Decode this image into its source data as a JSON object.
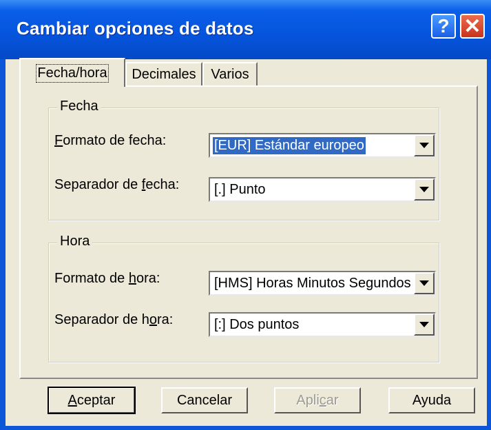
{
  "window": {
    "title": "Cambiar opciones de datos",
    "help_label": "?",
    "close_label": "✕"
  },
  "tabs": [
    {
      "label": "Fecha/hora",
      "active": true
    },
    {
      "label": "Decimales",
      "active": false
    },
    {
      "label": "Varios",
      "active": false
    }
  ],
  "fecha": {
    "group_title": "Fecha",
    "format_label_pre": "",
    "format_label_u": "F",
    "format_label_post": "ormato de fecha:",
    "format_value": "[EUR] Estándar europeo",
    "sep_label_pre": "Separador de ",
    "sep_label_u": "f",
    "sep_label_post": "echa:",
    "sep_value": "[.] Punto"
  },
  "hora": {
    "group_title": "Hora",
    "format_label_pre": "Formato de ",
    "format_label_u": "h",
    "format_label_post": "ora:",
    "format_value": "[HMS] Horas Minutos Segundos",
    "sep_label_pre": "Separador de h",
    "sep_label_u": "o",
    "sep_label_post": "ra:",
    "sep_value": "[:] Dos puntos"
  },
  "buttons": {
    "accept_pre": "",
    "accept_u": "A",
    "accept_post": "ceptar",
    "cancel": "Cancelar",
    "apply_pre": "Apli",
    "apply_u": "c",
    "apply_post": "ar",
    "help": "Ayuda"
  },
  "colors": {
    "titlebar": "#0654dc",
    "face": "#ece9d8",
    "selection": "#316ac5"
  }
}
